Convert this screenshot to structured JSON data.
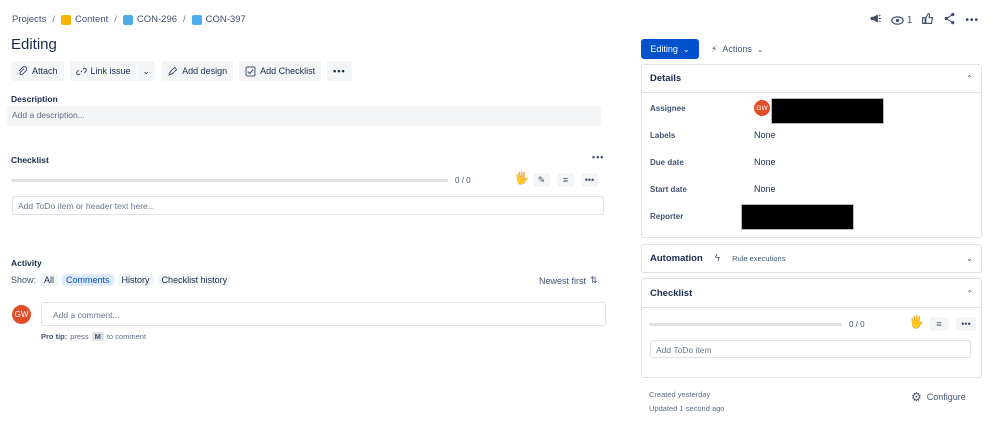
{
  "breadcrumb": {
    "items": [
      {
        "label": "Projects",
        "icon": ""
      },
      {
        "label": "Content",
        "icon": "project-icon"
      },
      {
        "label": "CON-296",
        "icon": "epic-icon"
      },
      {
        "label": "CON-397",
        "icon": "task-icon"
      }
    ]
  },
  "header": {
    "title": "Editing",
    "watch_count": "1"
  },
  "toolbar": {
    "attach": "Attach",
    "link_issue": "Link issue",
    "add_design": "Add design",
    "add_checklist": "Add Checklist"
  },
  "description": {
    "label": "Description",
    "placeholder": "Add a description..."
  },
  "checklist": {
    "label": "Checklist",
    "progress": "0 / 0",
    "progress_fraction": 0,
    "input_placeholder": "Add ToDo item or header text here..."
  },
  "activity": {
    "label": "Activity",
    "show_label": "Show:",
    "filters": [
      "All",
      "Comments",
      "History",
      "Checklist history"
    ],
    "active_filter": "Comments",
    "sort": "Newest first",
    "comment_placeholder": "Add a comment...",
    "tip_prefix": "Pro tip:",
    "tip_press": "press",
    "tip_key": "M",
    "tip_suffix": "to comment",
    "avatar_initials": "GW"
  },
  "status": {
    "editing_label": "Editing",
    "actions_label": "Actions"
  },
  "details": {
    "title": "Details",
    "fields": [
      {
        "label": "Assignee",
        "value": ""
      },
      {
        "label": "Labels",
        "value": "None"
      },
      {
        "label": "Due date",
        "value": "None"
      },
      {
        "label": "Start date",
        "value": "None"
      },
      {
        "label": "Reporter",
        "value": ""
      }
    ],
    "assignee_initials": "GW"
  },
  "automation": {
    "title": "Automation",
    "rule_label": "Rule executions"
  },
  "checklist_panel": {
    "title": "Checklist",
    "progress": "0 / 0",
    "input_placeholder": "Add ToDo item"
  },
  "footer": {
    "created": "Created yesterday",
    "updated": "Updated 1 second ago",
    "configure": "Configure"
  },
  "colors": {
    "primary": "#0052cc",
    "avatar": "#e04e2a",
    "text": "#172b4d"
  }
}
